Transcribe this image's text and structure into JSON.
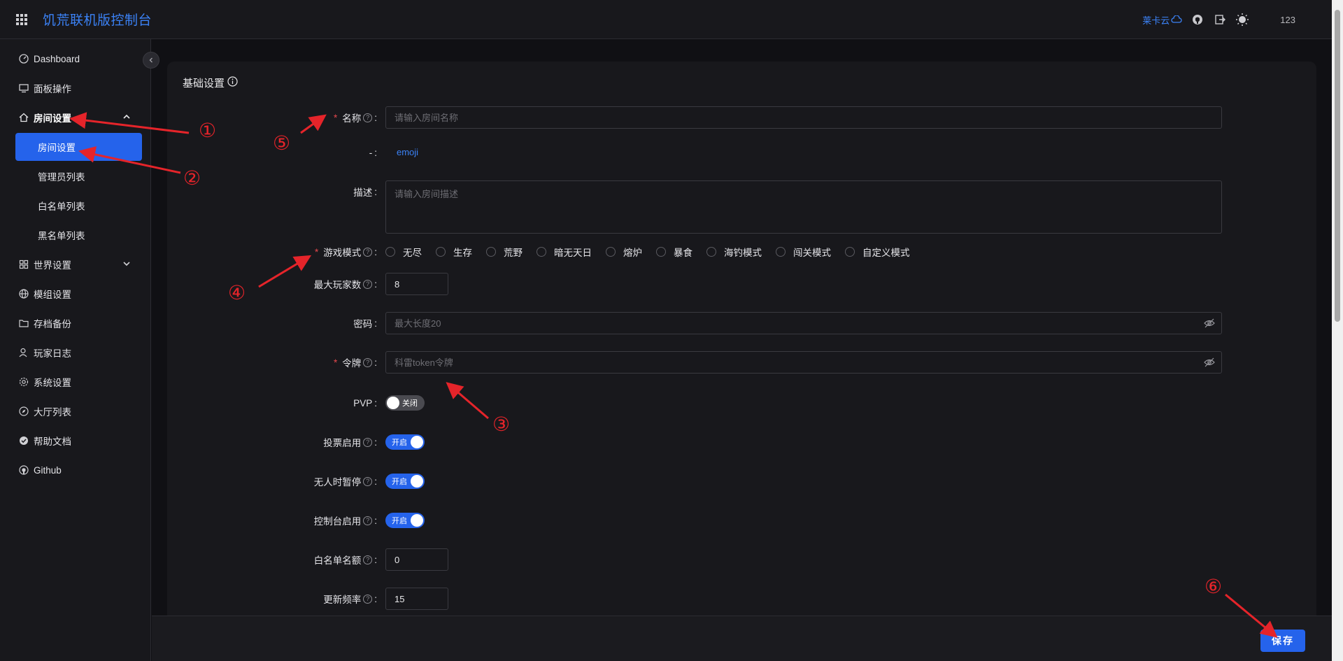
{
  "header": {
    "title": "饥荒联机版控制台",
    "cloud_link": "莱卡云",
    "user": "123"
  },
  "sidebar": {
    "items": [
      {
        "label": "Dashboard",
        "icon": "dashboard-icon"
      },
      {
        "label": "面板操作",
        "icon": "monitor-icon"
      },
      {
        "label": "房间设置",
        "icon": "home-icon"
      },
      {
        "label": "世界设置",
        "icon": "grid-icon"
      },
      {
        "label": "模组设置",
        "icon": "globe-icon"
      },
      {
        "label": "存档备份",
        "icon": "folder-icon"
      },
      {
        "label": "玩家日志",
        "icon": "user-icon"
      },
      {
        "label": "系统设置",
        "icon": "gear-icon"
      },
      {
        "label": "大厅列表",
        "icon": "compass-icon"
      },
      {
        "label": "帮助文档",
        "icon": "check-circle-icon"
      },
      {
        "label": "Github",
        "icon": "github-icon"
      }
    ],
    "sub_items": [
      "房间设置",
      "管理员列表",
      "白名单列表",
      "黑名单列表"
    ]
  },
  "form": {
    "section_title": "基础设置",
    "name_label": "名称",
    "name_placeholder": "请输入房间名称",
    "dash_label": "-",
    "emoji_link": "emoji",
    "desc_label": "描述",
    "desc_placeholder": "请输入房间描述",
    "mode_label": "游戏模式",
    "modes": [
      "无尽",
      "生存",
      "荒野",
      "暗无天日",
      "熔炉",
      "暴食",
      "海钓模式",
      "闯关模式",
      "自定义模式"
    ],
    "max_players_label": "最大玩家数",
    "max_players_value": "8",
    "password_label": "密码",
    "password_placeholder": "最大长度20",
    "token_label": "令牌",
    "token_placeholder": "科雷token令牌",
    "pvp_label": "PVP",
    "pvp_state": "关闭",
    "vote_label": "投票启用",
    "vote_state": "开启",
    "pause_label": "无人时暂停",
    "pause_state": "开启",
    "console_label": "控制台启用",
    "console_state": "开启",
    "whitelist_label": "白名单名额",
    "whitelist_value": "0",
    "tick_label": "更新频率",
    "tick_value": "15"
  },
  "footer": {
    "save_label": "保存"
  },
  "annotations": [
    "①",
    "②",
    "③",
    "④",
    "⑤",
    "⑥"
  ],
  "colors": {
    "accent": "#2563eb",
    "link": "#3b82f6",
    "annotation": "#e5242a"
  }
}
